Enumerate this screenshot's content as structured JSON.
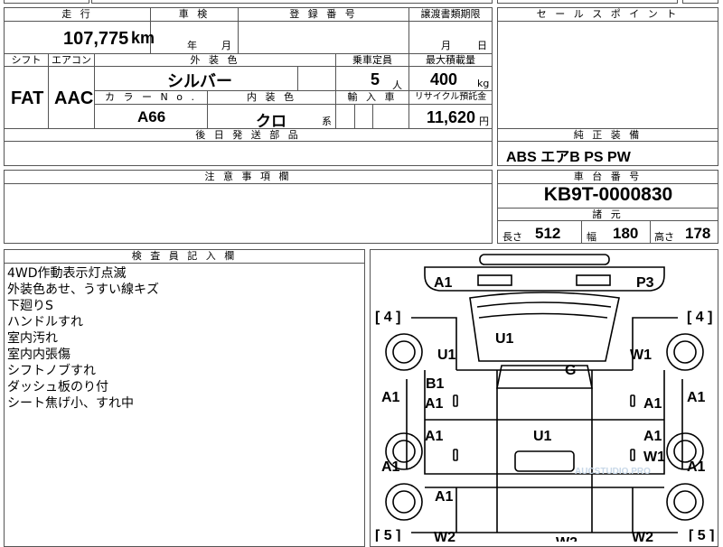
{
  "top_left_fragment": "",
  "top_mid_fragment": "",
  "mileage": {
    "header": "走 行",
    "value": "107,775",
    "unit": "km"
  },
  "inspection": {
    "header": "車 検",
    "year_label": "年",
    "month_label": "月"
  },
  "registration": {
    "header": "登 録 番 号",
    "value": ""
  },
  "transfer_deadline": {
    "header": "譲渡書類期限",
    "month_label": "月",
    "day_label": "日"
  },
  "sales_point": {
    "header": "セ ー ル ス ポ イ ン ト"
  },
  "shift": {
    "header": "シフト",
    "value": "FAT"
  },
  "aircon": {
    "header": "エアコン",
    "value": "AAC"
  },
  "exterior_color": {
    "header": "外 装 色",
    "value": "シルバー"
  },
  "capacity": {
    "header": "乗車定員",
    "value": "5",
    "unit": "人"
  },
  "max_load": {
    "header": "最大積載量",
    "value": "400",
    "unit": "kg"
  },
  "color_no": {
    "header": "カ ラ ー N o .",
    "value": "A66"
  },
  "interior_color": {
    "header": "内 装 色",
    "value": "クロ",
    "suffix": "系"
  },
  "import_car": {
    "header": "輸 入 車"
  },
  "recycle_fee": {
    "header": "リサイクル預託金",
    "value": "11,620",
    "unit": "円"
  },
  "later_parts": {
    "header": "後 日 発 送 部 品"
  },
  "equipment": {
    "header": "純 正 装 備",
    "value": "ABS エアB PS PW"
  },
  "caution": {
    "header": "注 意 事 項 欄"
  },
  "chassis": {
    "header": "車 台 番 号",
    "value": "KB9T-0000830"
  },
  "dimensions": {
    "header": "諸 元",
    "length_label": "長さ",
    "length": "512",
    "width_label": "幅",
    "width": "180",
    "height_label": "高さ",
    "height": "178"
  },
  "inspector": {
    "header": "検 査 員 記 入 欄",
    "notes": [
      "4WD作動表示灯点滅",
      "外装色あせ、うすい線キズ",
      "下廻りS",
      "ハンドルすれ",
      "室内汚れ",
      "室内内張傷",
      "シフトノブすれ",
      "ダッシュ板のり付",
      "シート焦げ小、すれ中"
    ]
  },
  "diagram": {
    "tire_labels": [
      "[ 4 ]",
      "[ 4 ]",
      "[ 5 ]",
      "[ 5 ]"
    ],
    "marks": {
      "front_left": "A1",
      "front_right": "P3",
      "hood": "U1",
      "roof": "G",
      "cargo": "U1",
      "left_fender": "U1",
      "right_fender": "W1",
      "left_side_front": "A1",
      "right_side_front": "A1",
      "left_front_door_b": "B1",
      "left_front_door_a": "A1",
      "right_front_door": "A1",
      "left_rear_door": "A1",
      "right_rear_door_a": "A1",
      "right_rear_door_w": "W1",
      "left_side_rear": "A1",
      "right_side_rear": "A1",
      "left_rear_quarter": "A1",
      "rear_left": "W2",
      "rear_center": "W2",
      "rear_right": "W2"
    },
    "watermark": "AUCSTUDIO.PRO"
  }
}
